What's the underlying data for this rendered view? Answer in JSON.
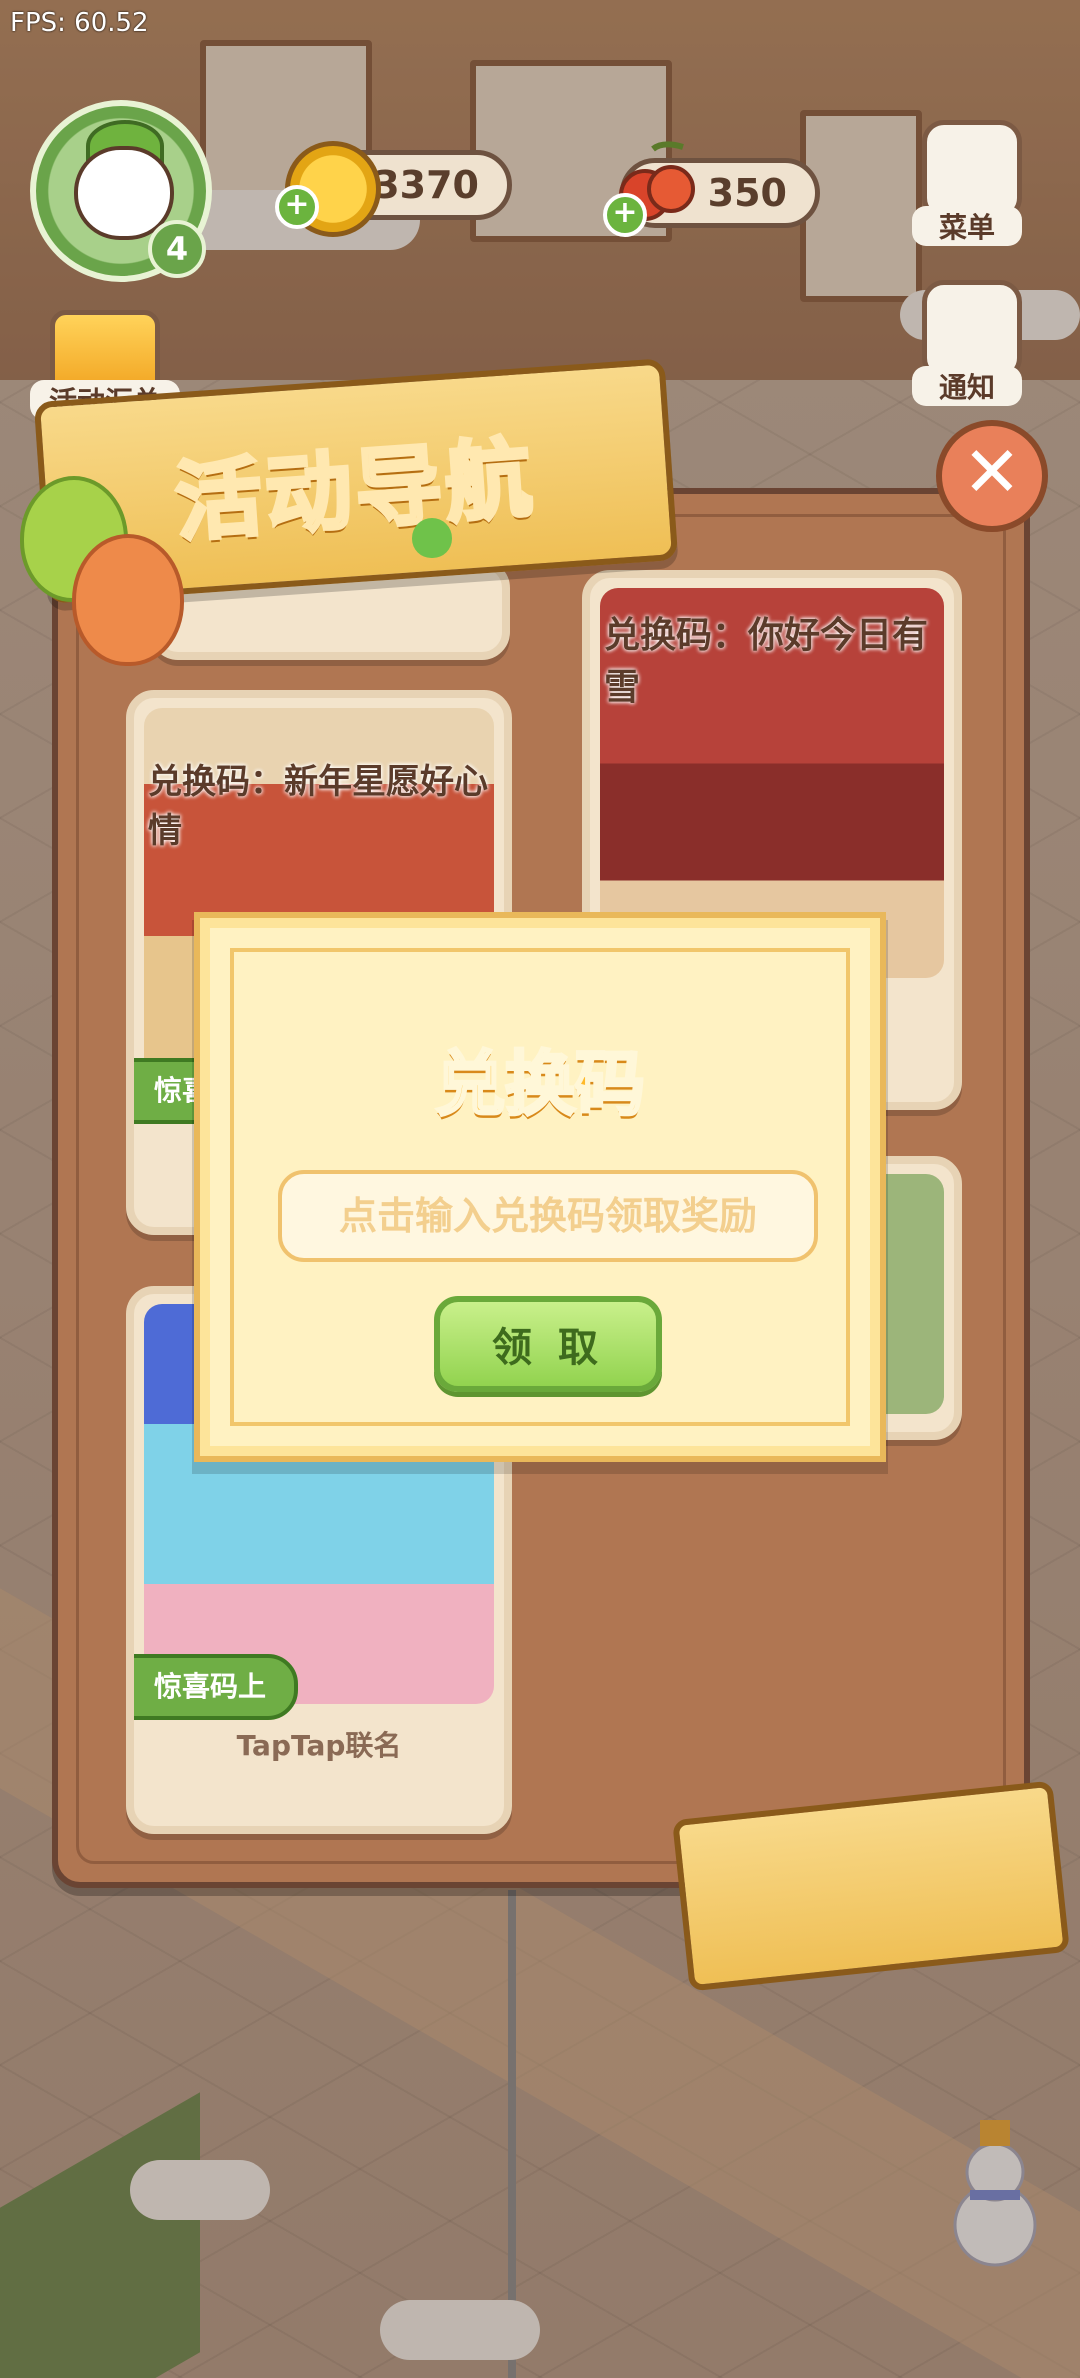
{
  "fps": "FPS: 60.52",
  "player": {
    "level": "4"
  },
  "currencies": {
    "coins": "3370",
    "cherries": "350"
  },
  "side_buttons": {
    "menu": "菜单",
    "notice": "通知",
    "events": "活动汇总"
  },
  "panel": {
    "title": "活动导航",
    "cards": [
      {
        "title": "兑换码：新年星愿好心情",
        "tag": "惊喜"
      },
      {
        "title": "兑换码：你好今日有雪"
      },
      {
        "tag": "惊喜码上",
        "footer": "TapTap联名"
      }
    ]
  },
  "dialog": {
    "title": "兑换码",
    "input_placeholder": "点击输入兑换码领取奖励",
    "claim_label": "领 取"
  },
  "colors": {
    "panel": "#b07652",
    "accent_green": "#92d34f",
    "title_gold": "#ffb92a"
  }
}
